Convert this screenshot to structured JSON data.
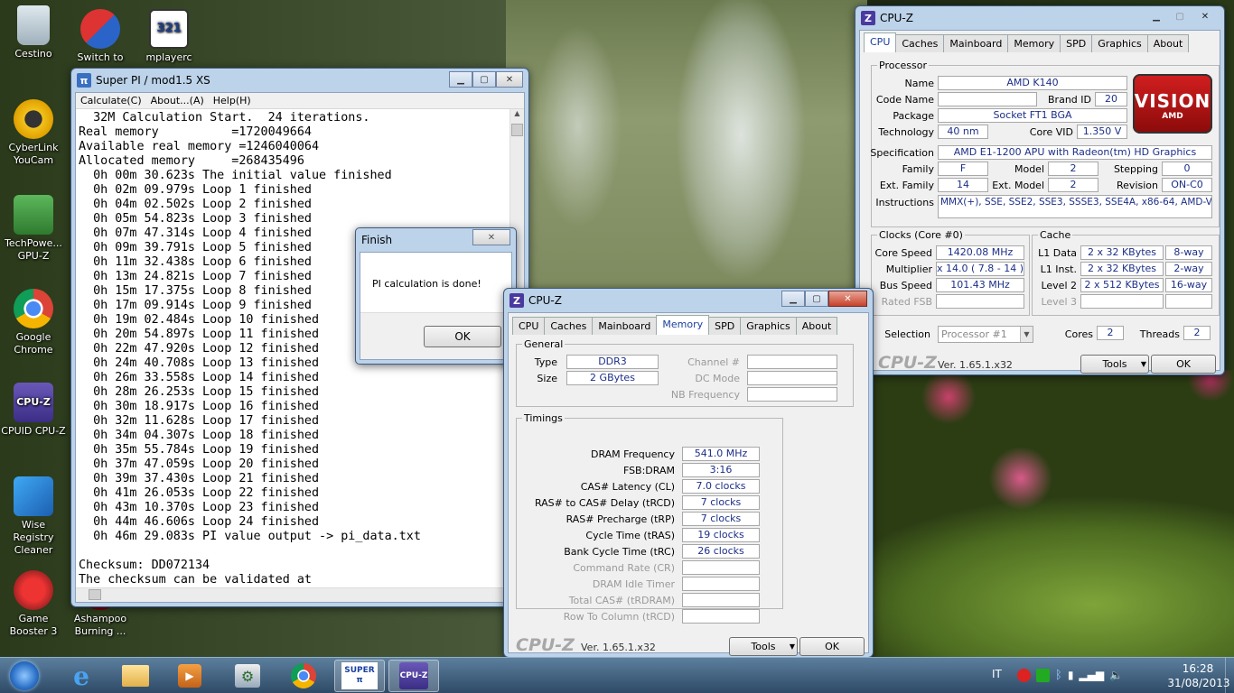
{
  "desktop": {
    "icons": [
      {
        "label": "Cestino",
        "icon": "recycle-bin-icon"
      },
      {
        "label": "Switch to",
        "icon": "switch-shield-icon"
      },
      {
        "label": "mplayerc",
        "icon": "media-player-icon",
        "glyph": "321"
      },
      {
        "label": "CyberLink YouCam",
        "icon": "webcam-icon"
      },
      {
        "label": "TechPowe... GPU-Z",
        "icon": "gpuz-icon"
      },
      {
        "label": "Google Chrome",
        "icon": "chrome-icon"
      },
      {
        "label": "CPUID CPU-Z",
        "icon": "cpuz-icon",
        "glyph": "CPU-Z"
      },
      {
        "label": "Wise Registry Cleaner",
        "icon": "registry-cleaner-icon"
      },
      {
        "label": "Game Booster 3",
        "icon": "game-booster-icon"
      },
      {
        "label": "Ashampoo Burning ...",
        "icon": "ashampoo-icon"
      }
    ]
  },
  "superpi": {
    "title": "Super PI / mod1.5 XS",
    "menu": [
      "Calculate(C)",
      "About...(A)",
      "Help(H)"
    ],
    "lines": [
      "  32M Calculation Start.  24 iterations.",
      "Real memory          =1720049664",
      "Available real memory =1246040064",
      "Allocated memory     =268435496",
      "  0h 00m 30.623s The initial value finished",
      "  0h 02m 09.979s Loop 1 finished",
      "  0h 04m 02.502s Loop 2 finished",
      "  0h 05m 54.823s Loop 3 finished",
      "  0h 07m 47.314s Loop 4 finished",
      "  0h 09m 39.791s Loop 5 finished",
      "  0h 11m 32.438s Loop 6 finished",
      "  0h 13m 24.821s Loop 7 finished",
      "  0h 15m 17.375s Loop 8 finished",
      "  0h 17m 09.914s Loop 9 finished",
      "  0h 19m 02.484s Loop 10 finished",
      "  0h 20m 54.897s Loop 11 finished",
      "  0h 22m 47.920s Loop 12 finished",
      "  0h 24m 40.708s Loop 13 finished",
      "  0h 26m 33.558s Loop 14 finished",
      "  0h 28m 26.253s Loop 15 finished",
      "  0h 30m 18.917s Loop 16 finished",
      "  0h 32m 11.628s Loop 17 finished",
      "  0h 34m 04.307s Loop 18 finished",
      "  0h 35m 55.784s Loop 19 finished",
      "  0h 37m 47.059s Loop 20 finished",
      "  0h 39m 37.430s Loop 21 finished",
      "  0h 41m 26.053s Loop 22 finished",
      "  0h 43m 10.370s Loop 23 finished",
      "  0h 44m 46.606s Loop 24 finished",
      "  0h 46m 29.083s PI value output -> pi_data.txt",
      "",
      "Checksum: DD072134",
      "The checksum can be validated at"
    ]
  },
  "finish": {
    "title": "Finish",
    "message": "PI calculation is done!",
    "ok": "OK"
  },
  "cpuz_cpu": {
    "title": "CPU-Z",
    "tabs": [
      "CPU",
      "Caches",
      "Mainboard",
      "Memory",
      "SPD",
      "Graphics",
      "About"
    ],
    "processor_legend": "Processor",
    "name_label": "Name",
    "name": "AMD K140",
    "codename_label": "Code Name",
    "codename": "",
    "brandid_label": "Brand ID",
    "brandid": "20",
    "package_label": "Package",
    "package": "Socket FT1 BGA",
    "tech_label": "Technology",
    "tech": "40 nm",
    "vid_label": "Core VID",
    "vid": "1.350 V",
    "spec_label": "Specification",
    "spec": "AMD E1-1200 APU with Radeon(tm) HD Graphics",
    "family_label": "Family",
    "family": "F",
    "model_label": "Model",
    "model": "2",
    "stepping_label": "Stepping",
    "stepping": "0",
    "extfamily_label": "Ext. Family",
    "extfamily": "14",
    "extmodel_label": "Ext. Model",
    "extmodel": "2",
    "revision_label": "Revision",
    "revision": "ON-C0",
    "instr_label": "Instructions",
    "instr": "MMX(+), SSE, SSE2, SSE3, SSSE3, SSE4A, x86-64, AMD-V",
    "logo_main": "VISION",
    "logo_sub": "AMD",
    "clocks_legend": "Clocks (Core #0)",
    "corespeed_label": "Core Speed",
    "corespeed": "1420.08 MHz",
    "mult_label": "Multiplier",
    "mult": "x 14.0 ( 7.8 - 14 )",
    "bus_label": "Bus Speed",
    "bus": "101.43 MHz",
    "fsb_label": "Rated FSB",
    "fsb": "",
    "cache_legend": "Cache",
    "l1d_label": "L1 Data",
    "l1d": "2 x 32 KBytes",
    "l1d_way": "8-way",
    "l1i_label": "L1 Inst.",
    "l1i": "2 x 32 KBytes",
    "l1i_way": "2-way",
    "l2_label": "Level 2",
    "l2": "2 x 512 KBytes",
    "l2_way": "16-way",
    "l3_label": "Level 3",
    "l3": "",
    "l3_way": "",
    "selection_label": "Selection",
    "selection": "Processor #1",
    "cores_label": "Cores",
    "cores": "2",
    "threads_label": "Threads",
    "threads": "2",
    "brand": "CPU-Z",
    "version": "Ver. 1.65.1.x32",
    "tools": "Tools",
    "ok": "OK"
  },
  "cpuz_mem": {
    "title": "CPU-Z",
    "tabs": [
      "CPU",
      "Caches",
      "Mainboard",
      "Memory",
      "SPD",
      "Graphics",
      "About"
    ],
    "general_legend": "General",
    "type_label": "Type",
    "type": "DDR3",
    "size_label": "Size",
    "size": "2 GBytes",
    "channel_label": "Channel #",
    "channel": "",
    "dcmode_label": "DC Mode",
    "dcmode": "",
    "nbfreq_label": "NB Frequency",
    "nbfreq": "",
    "timings_legend": "Timings",
    "timings": [
      {
        "label": "DRAM Frequency",
        "value": "541.0 MHz",
        "enabled": true
      },
      {
        "label": "FSB:DRAM",
        "value": "3:16",
        "enabled": true
      },
      {
        "label": "CAS# Latency (CL)",
        "value": "7.0 clocks",
        "enabled": true
      },
      {
        "label": "RAS# to CAS# Delay (tRCD)",
        "value": "7 clocks",
        "enabled": true
      },
      {
        "label": "RAS# Precharge (tRP)",
        "value": "7 clocks",
        "enabled": true
      },
      {
        "label": "Cycle Time (tRAS)",
        "value": "19 clocks",
        "enabled": true
      },
      {
        "label": "Bank Cycle Time (tRC)",
        "value": "26 clocks",
        "enabled": true
      },
      {
        "label": "Command Rate (CR)",
        "value": "",
        "enabled": false
      },
      {
        "label": "DRAM Idle Timer",
        "value": "",
        "enabled": false
      },
      {
        "label": "Total CAS# (tRDRAM)",
        "value": "",
        "enabled": false
      },
      {
        "label": "Row To Column (tRCD)",
        "value": "",
        "enabled": false
      }
    ],
    "brand": "CPU-Z",
    "version": "Ver. 1.65.1.x32",
    "tools": "Tools",
    "ok": "OK"
  },
  "taskbar": {
    "items": [
      {
        "name": "start-button",
        "icon": "windows-logo-icon",
        "open": false
      },
      {
        "name": "taskbar-internet-explorer",
        "icon": "ie-icon",
        "open": false
      },
      {
        "name": "taskbar-explorer",
        "icon": "folder-icon",
        "open": false
      },
      {
        "name": "taskbar-media-player",
        "icon": "media-icon",
        "open": false
      },
      {
        "name": "taskbar-control-panel",
        "icon": "control-panel-icon",
        "open": false
      },
      {
        "name": "taskbar-chrome",
        "icon": "chrome-icon",
        "open": false
      },
      {
        "name": "taskbar-superpi",
        "icon": "superpi-icon",
        "open": true,
        "glyph": "SUPER π"
      },
      {
        "name": "taskbar-cpuz",
        "icon": "cpuz-icon",
        "open": true,
        "glyph": "CPU-Z"
      }
    ],
    "lang": "IT",
    "time": "16:28",
    "date": "31/08/2013"
  }
}
